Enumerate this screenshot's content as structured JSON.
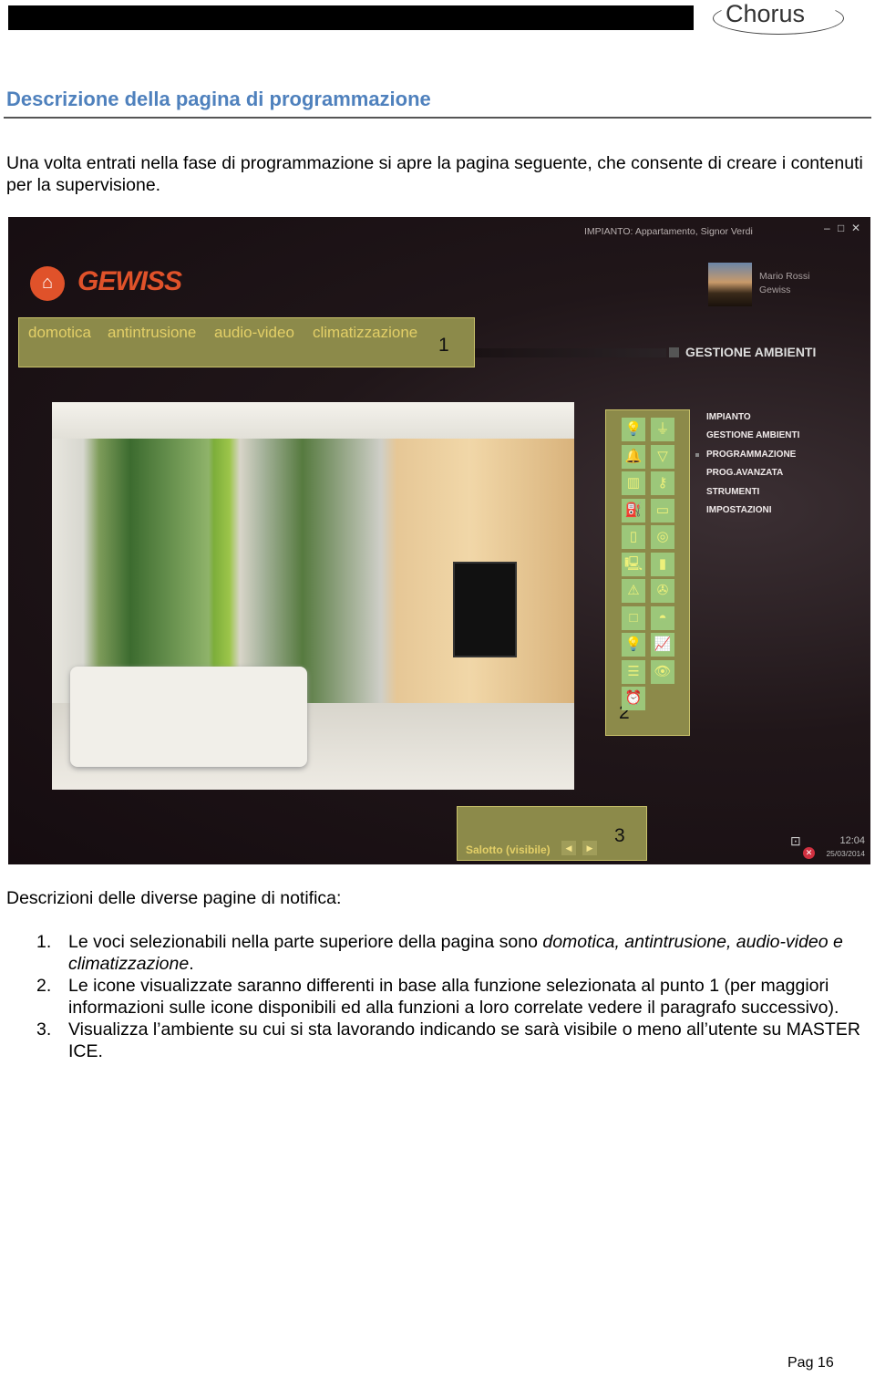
{
  "header": {
    "logo": "Chorus"
  },
  "title": "Descrizione della pagina di programmazione",
  "intro": "Una volta entrati nella fase di programmazione si apre la pagina seguente, che consente di creare i contenuti per la supervisione.",
  "screenshot": {
    "window_title": "IMPIANTO: Appartamento, Signor Verdi",
    "window_controls": [
      "minimize-icon",
      "maximize-icon",
      "close-icon"
    ],
    "brand": "GEWISS",
    "user": {
      "name": "Mario Rossi",
      "company": "Gewiss"
    },
    "tabs": [
      "domotica",
      "antintrusione",
      "audio-video",
      "climatizzazione"
    ],
    "callouts": [
      "1",
      "2",
      "3"
    ],
    "section_title": "GESTIONE AMBIENTI",
    "menu": [
      "IMPIANTO",
      "GESTIONE AMBIENTI",
      "PROGRAMMAZIONE",
      "PROG.AVANZATA",
      "STRUMENTI",
      "IMPOSTAZIONI"
    ],
    "menu_selected": "PROGRAMMAZIONE",
    "icons": [
      "light-bulb",
      "plug",
      "bell",
      "sprinkler",
      "gate",
      "key",
      "fuel-pump",
      "card-reader",
      "fridge",
      "washing-machine",
      "computer",
      "door",
      "warning",
      "fan",
      "window",
      "camera",
      "light-bulb",
      "chart",
      "shutter",
      "eye",
      "alarm-clock"
    ],
    "room_label": "Salotto (visibile)",
    "time": "12:04",
    "date": "25/03/2014",
    "colors": {
      "panel": "#8c8a4a",
      "panel_border": "#c9c26a",
      "tab_text": "#e3cf67",
      "icon_bg": "#9cc77a",
      "accent_brand": "#e0522a"
    }
  },
  "notif_heading": "Descrizioni delle diverse pagine di notifica:",
  "list": [
    {
      "n": "1.",
      "pre": "Le voci selezionabili nella parte superiore della pagina sono ",
      "em": "domotica, antintrusione, audio-video e climatizzazione",
      "post": "."
    },
    {
      "n": "2.",
      "text": "Le icone visualizzate saranno differenti in base alla funzione selezionata al punto 1 (per maggiori informazioni sulle icone disponibili ed alla funzioni a loro correlate vedere il paragrafo successivo)."
    },
    {
      "n": "3.",
      "text": "Visualizza l’ambiente su cui si sta lavorando indicando se sarà visibile o meno all’utente su MASTER ICE."
    }
  ],
  "page": "Pag 16"
}
